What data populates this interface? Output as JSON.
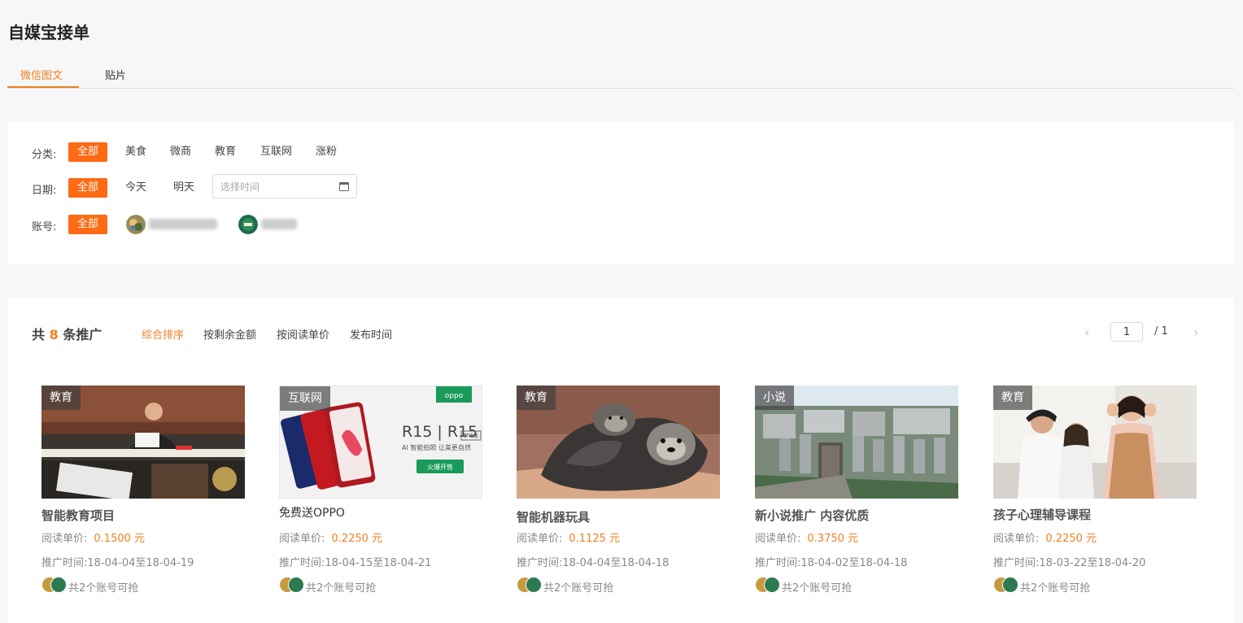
{
  "page": {
    "title": "自媒宝接单"
  },
  "tabs": [
    {
      "label": "微信图文"
    },
    {
      "label": "贴片"
    }
  ],
  "filters": {
    "category": {
      "label": "分类:",
      "options": [
        "全部",
        "美食",
        "微商",
        "教育",
        "互联网",
        "涨粉"
      ]
    },
    "date": {
      "label": "日期:",
      "options": [
        "全部",
        "今天",
        "明天"
      ],
      "placeholder": "选择时间"
    },
    "account": {
      "label": "账号:",
      "all": "全部"
    }
  },
  "list": {
    "total_prefix": "共",
    "total_count": "8",
    "total_suffix": "条推广",
    "sort_options": [
      "综合排序",
      "按剩余金额",
      "按阅读单价",
      "发布时间"
    ],
    "pagination": {
      "current": "1",
      "total_text": "/  1",
      "prev": "‹",
      "next": "›"
    }
  },
  "cards": [
    {
      "tag": "教育",
      "title": "智能教育项目",
      "price_label": "阅读单价:",
      "price": "0.1500 元",
      "time_label": "推广时间:",
      "time": "18-04-04至18-04-19",
      "accounts": "共2个账号可抢"
    },
    {
      "tag": "互联网",
      "title": "免费送OPPO",
      "price_label": "阅读单价:",
      "price": "0.2250 元",
      "time_label": "推广时间:",
      "time": "18-04-15至18-04-21",
      "accounts": "共2个账号可抢",
      "ad_brand": "oppo",
      "ad_model": "R15 | R15",
      "ad_badge": "梦境版",
      "ad_slogan": "AI 智能拍照   让美更自然",
      "ad_button": "火爆开售"
    },
    {
      "tag": "教育",
      "title": "智能机器玩具",
      "price_label": "阅读单价:",
      "price": "0.1125 元",
      "time_label": "推广时间:",
      "time": "18-04-04至18-04-18",
      "accounts": "共2个账号可抢"
    },
    {
      "tag": "小说",
      "title": "新小说推广 内容优质",
      "price_label": "阅读单价:",
      "price": "0.3750 元",
      "time_label": "推广时间:",
      "time": "18-04-02至18-04-18",
      "accounts": "共2个账号可抢"
    },
    {
      "tag": "教育",
      "title": "孩子心理辅导课程",
      "price_label": "阅读单价:",
      "price": "0.2250 元",
      "time_label": "推广时间:",
      "time": "18-03-22至18-04-20",
      "accounts": "共2个账号可抢"
    }
  ],
  "colors": {
    "accent": "#f47f20",
    "chip_active": "#ff6a14",
    "background": "#f7f7f7"
  }
}
